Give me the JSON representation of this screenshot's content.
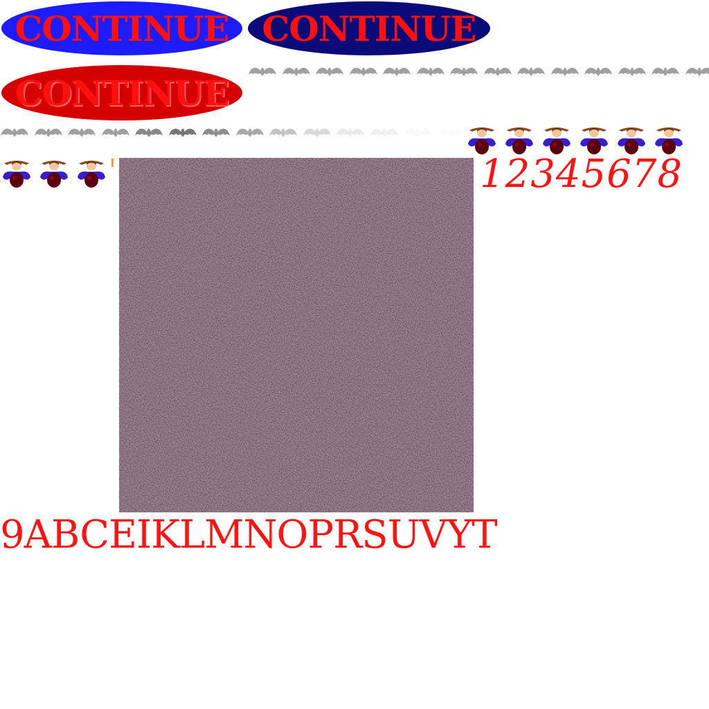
{
  "buttons": {
    "continue_normal": "CONTINUE",
    "continue_hover": "CONTINUE",
    "continue_pressed": "CONTINUE"
  },
  "font_sheet": {
    "digits": "12345678",
    "letters": "9ABCEIKLMNOPRSUVYT"
  },
  "sprites": {
    "bat_icon": "bat-icon",
    "character_icon": "character-icon",
    "texture": "granite-texture"
  },
  "colors": {
    "text_red": "#ff1414",
    "button_blue": "#1c1cff",
    "button_navy": "#0a0a78",
    "button_red": "#d40000",
    "bat_gray": "#9a9a9a",
    "texture_base": "#3a2530"
  }
}
